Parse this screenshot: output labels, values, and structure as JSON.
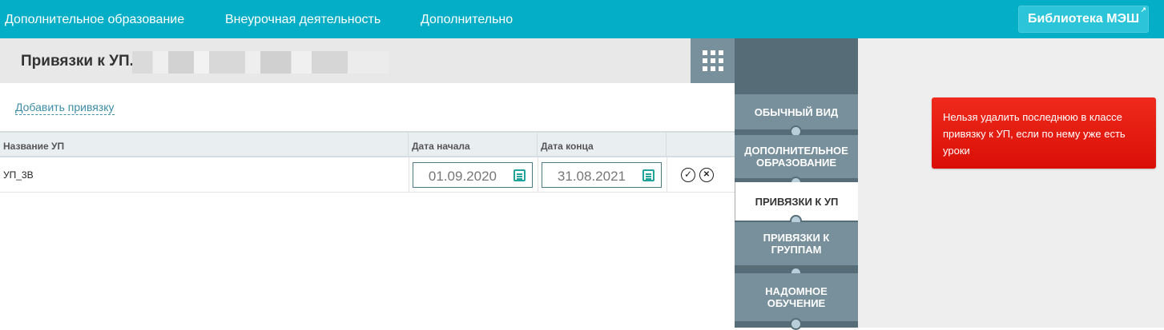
{
  "topnav": {
    "items": [
      "Дополнительное образование",
      "Внеурочная деятельность",
      "Дополнительно"
    ],
    "library_button": "Библиотека МЭШ"
  },
  "page": {
    "title": "Привязки к УП."
  },
  "actions": {
    "add_link": "Добавить привязку"
  },
  "table": {
    "headers": [
      "Название УП",
      "Дата начала",
      "Дата конца"
    ],
    "rows": [
      {
        "name": "УП_3В",
        "start": "01.09.2020",
        "end": "31.08.2021"
      }
    ],
    "row_actions": {
      "confirm_glyph": "✓",
      "cancel_glyph": "✕"
    }
  },
  "sidebar": {
    "items": [
      {
        "label": "ОБЫЧНЫЙ ВИД",
        "active": false
      },
      {
        "label": "ДОПОЛНИТЕЛЬНОЕ ОБРАЗОВАНИЕ",
        "active": false
      },
      {
        "label": "ПРИВЯЗКИ К УП",
        "active": true
      },
      {
        "label": "ПРИВЯЗКИ К ГРУППАМ",
        "active": false
      },
      {
        "label": "НАДОМНОЕ ОБУЧЕНИЕ",
        "active": false
      }
    ]
  },
  "alert": {
    "message": "Нельзя удалить последнюю в классе привязку к УП, если по нему уже есть уроки"
  },
  "icons": {
    "grid": "grid-icon",
    "calendar": "calendar-icon",
    "external": "external-link-icon"
  },
  "colors": {
    "topbar": "#03aec6",
    "sidebar": "#78909c",
    "alert": "#e3170b",
    "link": "#3e8da6"
  }
}
